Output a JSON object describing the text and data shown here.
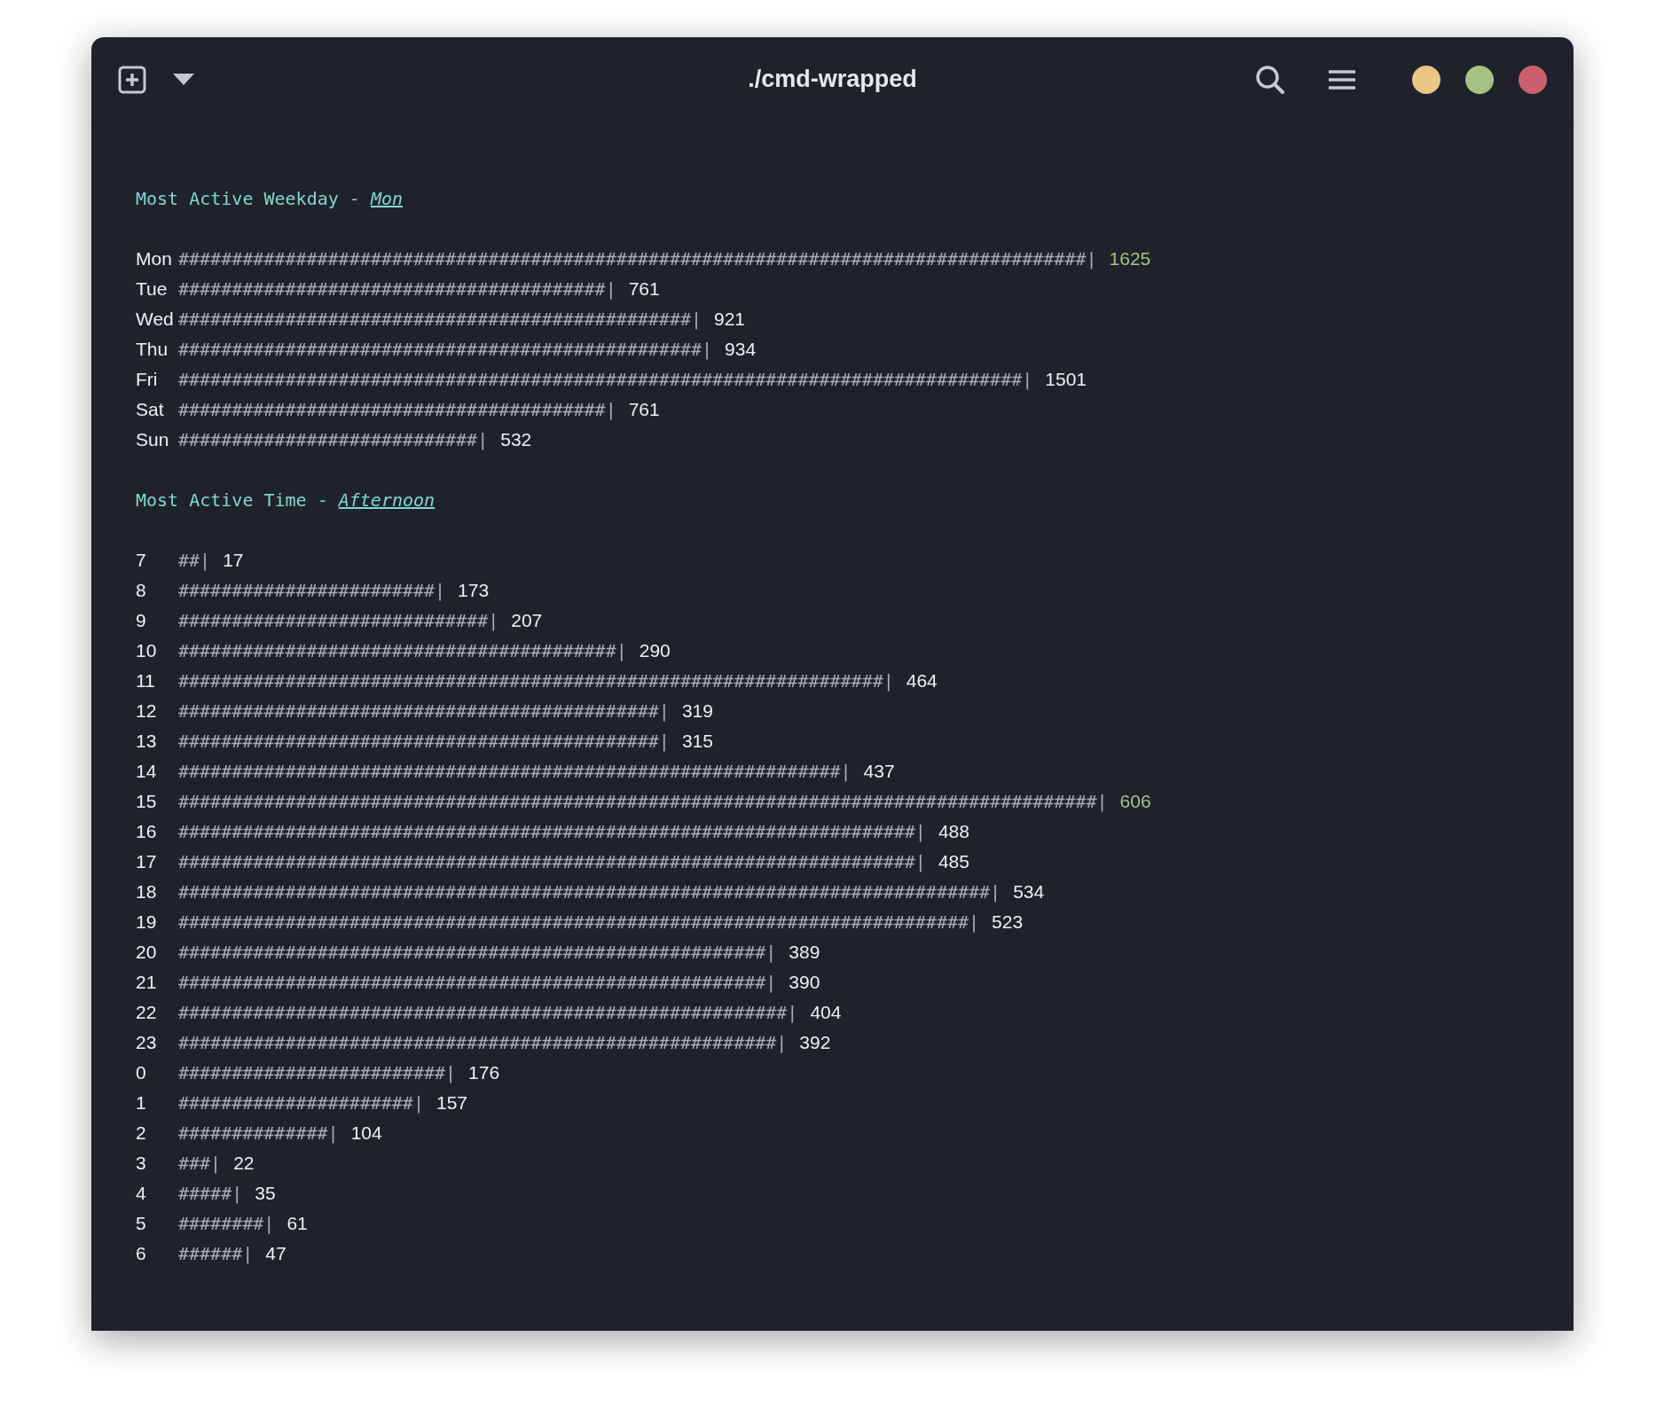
{
  "window": {
    "title": "./cmd-wrapped"
  },
  "sections": [
    {
      "heading": "Most Active Weekday -",
      "highlight": "Mon",
      "rows": [
        {
          "label": "Mon",
          "bar": "#####################################################################################|",
          "value": "1625",
          "top": true
        },
        {
          "label": "Tue",
          "bar": "########################################|",
          "value": "761",
          "top": false
        },
        {
          "label": "Wed",
          "bar": "################################################|",
          "value": "921",
          "top": false
        },
        {
          "label": "Thu",
          "bar": "#################################################|",
          "value": "934",
          "top": false
        },
        {
          "label": "Fri",
          "bar": "###############################################################################|",
          "value": "1501",
          "top": false
        },
        {
          "label": "Sat",
          "bar": "########################################|",
          "value": "761",
          "top": false
        },
        {
          "label": "Sun",
          "bar": "############################|",
          "value": "532",
          "top": false
        }
      ]
    },
    {
      "heading": "Most Active Time -",
      "highlight": "Afternoon",
      "rows": [
        {
          "label": "7",
          "bar": "##|",
          "value": "17",
          "top": false
        },
        {
          "label": "8",
          "bar": "########################|",
          "value": "173",
          "top": false
        },
        {
          "label": "9",
          "bar": "#############################|",
          "value": "207",
          "top": false
        },
        {
          "label": "10",
          "bar": "#########################################|",
          "value": "290",
          "top": false
        },
        {
          "label": "11",
          "bar": "##################################################################|",
          "value": "464",
          "top": false
        },
        {
          "label": "12",
          "bar": "#############################################|",
          "value": "319",
          "top": false
        },
        {
          "label": "13",
          "bar": "#############################################|",
          "value": "315",
          "top": false
        },
        {
          "label": "14",
          "bar": "##############################################################|",
          "value": "437",
          "top": false
        },
        {
          "label": "15",
          "bar": "######################################################################################|",
          "value": "606",
          "top": true
        },
        {
          "label": "16",
          "bar": "#####################################################################|",
          "value": "488",
          "top": false
        },
        {
          "label": "17",
          "bar": "#####################################################################|",
          "value": "485",
          "top": false
        },
        {
          "label": "18",
          "bar": "############################################################################|",
          "value": "534",
          "top": false
        },
        {
          "label": "19",
          "bar": "##########################################################################|",
          "value": "523",
          "top": false
        },
        {
          "label": "20",
          "bar": "#######################################################|",
          "value": "389",
          "top": false
        },
        {
          "label": "21",
          "bar": "#######################################################|",
          "value": "390",
          "top": false
        },
        {
          "label": "22",
          "bar": "#########################################################|",
          "value": "404",
          "top": false
        },
        {
          "label": "23",
          "bar": "########################################################|",
          "value": "392",
          "top": false
        },
        {
          "label": "0",
          "bar": "#########################|",
          "value": "176",
          "top": false
        },
        {
          "label": "1",
          "bar": "######################|",
          "value": "157",
          "top": false
        },
        {
          "label": "2",
          "bar": "##############|",
          "value": "104",
          "top": false
        },
        {
          "label": "3",
          "bar": "###|",
          "value": "22",
          "top": false
        },
        {
          "label": "4",
          "bar": "#####|",
          "value": "35",
          "top": false
        },
        {
          "label": "5",
          "bar": "########|",
          "value": "61",
          "top": false
        },
        {
          "label": "6",
          "bar": "######|",
          "value": "47",
          "top": false
        }
      ]
    }
  ]
}
